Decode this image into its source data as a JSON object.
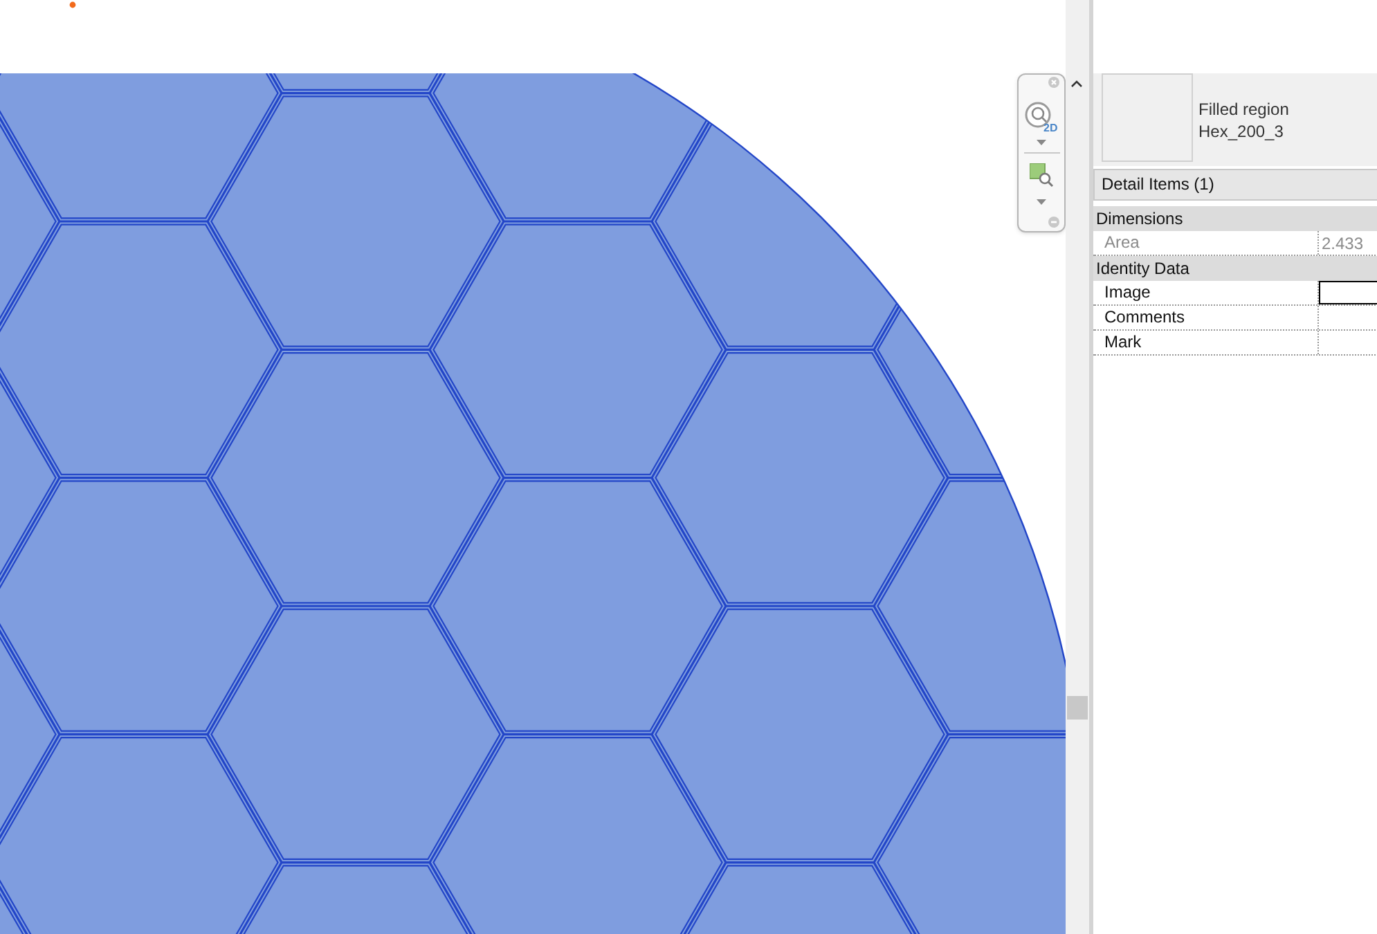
{
  "navigation_bar": {
    "zoom_label": "2D"
  },
  "type_selector": {
    "family": "Filled region",
    "type": "Hex_200_3"
  },
  "instance_filter": "Detail Items (1)",
  "groups": [
    {
      "title": "Dimensions",
      "rows": [
        {
          "label": "Area",
          "value": "2.433",
          "disabled": true,
          "selected": false
        }
      ]
    },
    {
      "title": "Identity Data",
      "rows": [
        {
          "label": "Image",
          "disabled": false,
          "selected": true
        },
        {
          "label": "Comments",
          "disabled": false,
          "selected": false
        },
        {
          "label": "Mark",
          "disabled": false,
          "selected": false
        }
      ]
    }
  ]
}
